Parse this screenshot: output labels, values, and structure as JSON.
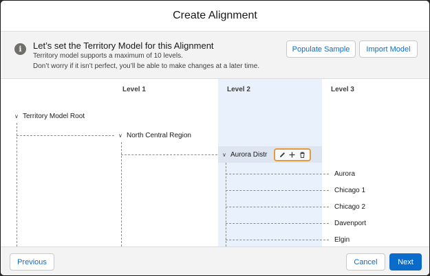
{
  "modal": {
    "title": "Create Alignment"
  },
  "info": {
    "icon": "info-icon",
    "title": "Let’s set the Territory Model for this Alignment",
    "line1": "Territory model supports a maximum of 10 levels.",
    "line2": "Don’t worry if it isn’t perfect, you’ll be able to make changes at a later time.",
    "populate_sample_label": "Populate Sample",
    "import_model_label": "Import Model"
  },
  "columns": [
    "Level 1",
    "Level 2",
    "Level 3"
  ],
  "tree": {
    "root": "Territory Model Root",
    "level1": "North Central Region",
    "level2": "Aurora Distr",
    "level3": [
      "Aurora",
      "Chicago 1",
      "Chicago 2",
      "Davenport",
      "Elgin"
    ]
  },
  "toolbar": {
    "icons": [
      "pencil-icon",
      "plus-icon",
      "trash-icon"
    ]
  },
  "footer": {
    "previous_label": "Previous",
    "cancel_label": "Cancel",
    "next_label": "Next"
  },
  "colors": {
    "accent": "#0b6bcb",
    "highlight": "#e59a3a",
    "selected_column": "#e9f2fc"
  }
}
